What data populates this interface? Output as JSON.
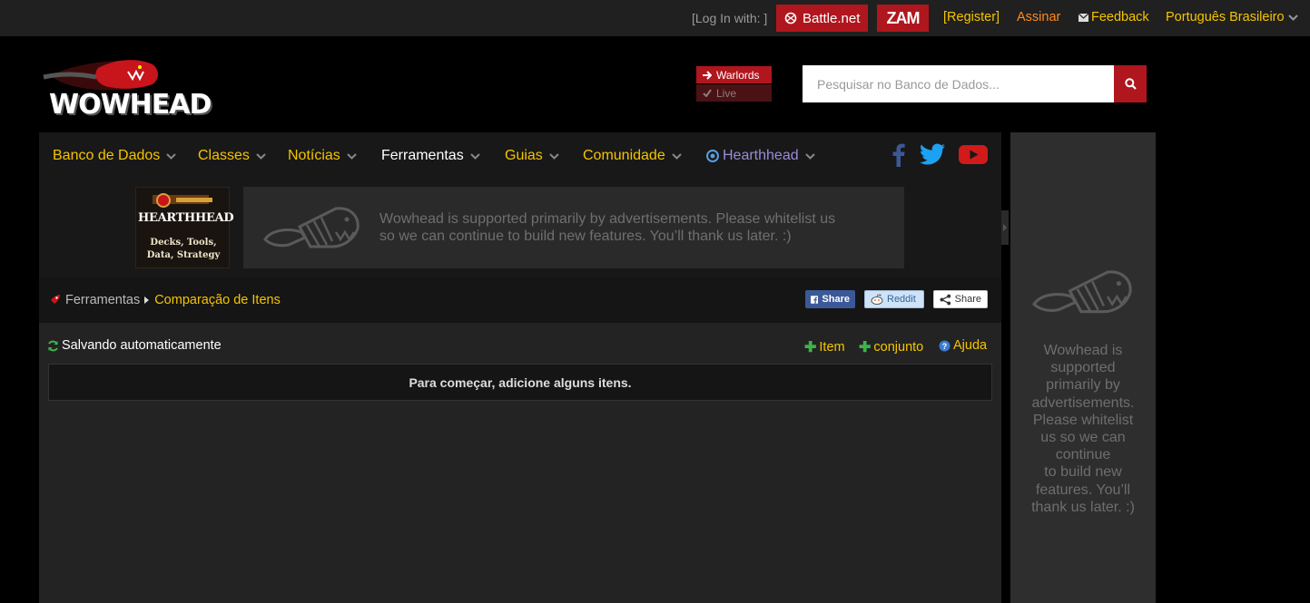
{
  "topbar": {
    "login_label": "[Log In with: ]",
    "battlenet_label": "Battle.net",
    "zam_label": "ZAM",
    "register_label": "[Register]",
    "assinar_label": "Assinar",
    "feedback_label": "Feedback",
    "language_label": "Português Brasileiro"
  },
  "header": {
    "logo_text": "WOWHEAD",
    "version": {
      "warlords_label": "Warlords",
      "live_label": "Live"
    },
    "search": {
      "placeholder": "Pesquisar no Banco de Dados..."
    }
  },
  "nav": {
    "items": [
      {
        "label": "Banco de Dados"
      },
      {
        "label": "Classes"
      },
      {
        "label": "Notícias"
      },
      {
        "label": "Ferramentas"
      },
      {
        "label": "Guias"
      },
      {
        "label": "Comunidade"
      },
      {
        "label": "Hearthhead"
      }
    ],
    "social_icons": [
      "facebook-icon",
      "twitter-icon",
      "youtube-icon"
    ]
  },
  "ads": {
    "hearthhead_title": "HEARTHHEAD",
    "hearthhead_sub1": "Decks, Tools,",
    "hearthhead_sub2": "Data, Strategy",
    "banner_line1": "Wowhead is supported primarily by advertisements. Please whitelist us",
    "banner_line2": "so we can continue to build new features. You’ll thank us later. :)",
    "sidebar_lines": [
      "Wowhead is",
      "supported",
      "primarily by",
      "advertisements.",
      "Please whitelist",
      "us so we can",
      "continue",
      "to build new",
      "features. You’ll",
      "thank us later. :)"
    ]
  },
  "breadcrumb": {
    "parent": "Ferramentas",
    "current": "Comparação de Itens"
  },
  "share": {
    "facebook_label": "Share",
    "reddit_label": "Reddit",
    "share_label": "Share"
  },
  "tool": {
    "autosave_label": "Salvando automaticamente",
    "add_item_label": "Item",
    "add_set_label": "conjunto",
    "help_label": "Ajuda",
    "empty_message": "Para começar, adicione alguns itens."
  },
  "colors": {
    "accent_red": "#b0161d",
    "link_yellow": "#f5c400",
    "assinar_orange": "#ff8a1c",
    "hearthhead_purple": "#9c8bd8",
    "plus_green": "#3cb34a"
  }
}
